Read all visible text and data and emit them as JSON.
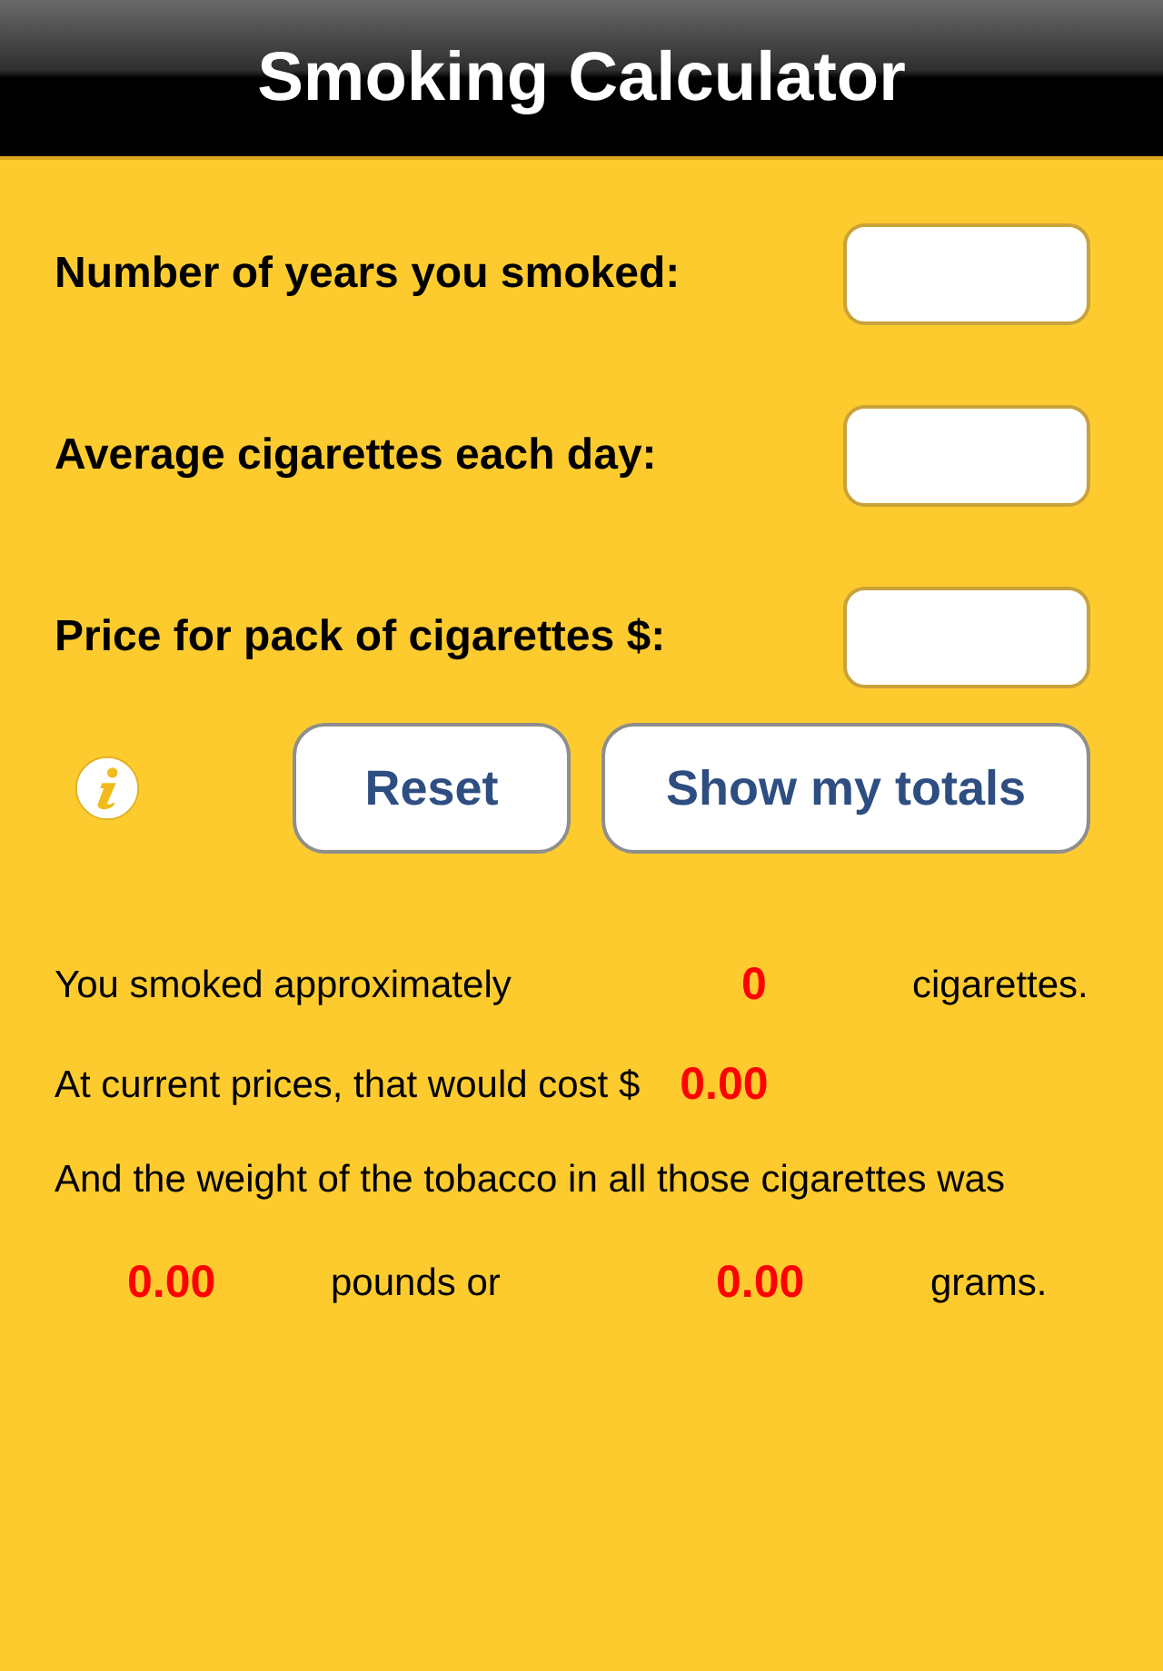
{
  "title": "Smoking Calculator",
  "fields": [
    {
      "label": "Number of years you smoked:"
    },
    {
      "label": "Average cigarettes each day:"
    },
    {
      "label": "Price for pack of cigarettes $:"
    }
  ],
  "buttons": [
    "Reset",
    "Show my totals"
  ],
  "results": {
    "cigarettes_prefix": "You smoked approximately",
    "cigarettes": "0",
    "cigarettes_suffix": "cigarettes.",
    "cost_prefix": "At current prices, that would cost $",
    "cost": "0.00",
    "weight_sentence": "And the weight of the tobacco in all those cigarettes was",
    "pounds": "0.00",
    "pounds_suffix": "pounds or",
    "grams": "0.00",
    "grams_suffix": "grams."
  }
}
